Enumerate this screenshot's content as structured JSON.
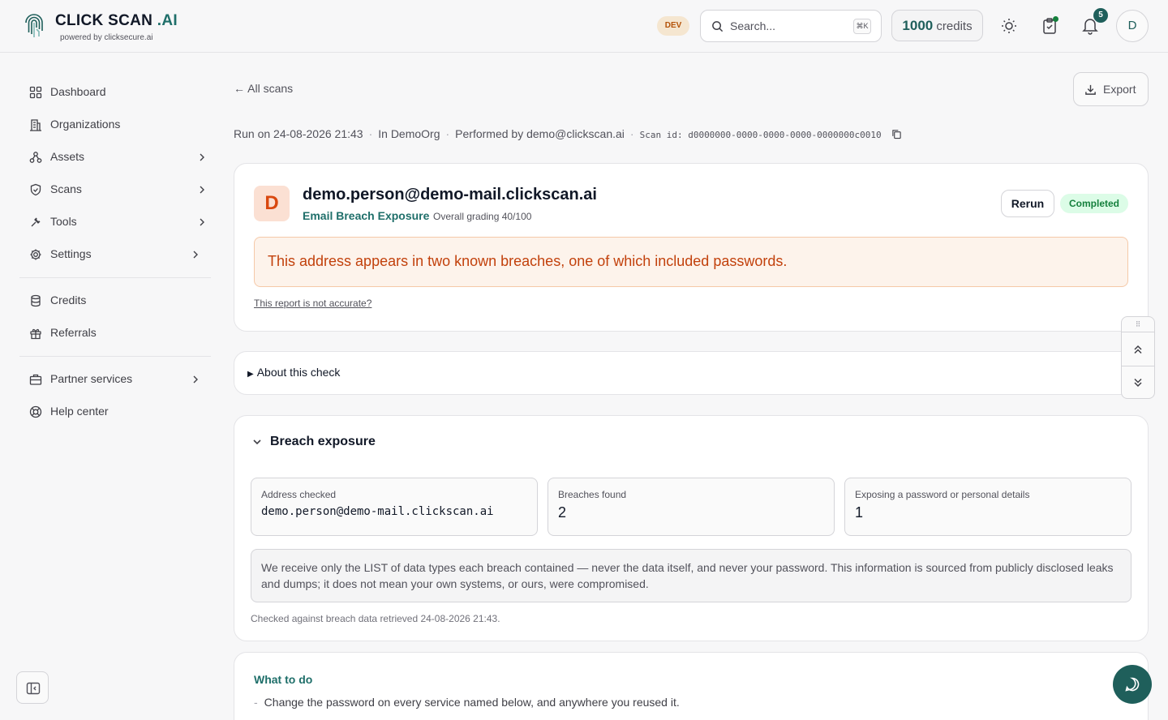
{
  "header": {
    "brand_name": "CLICK SCAN",
    "brand_suffix": ".AI",
    "brand_sub": "powered by clicksecure.ai",
    "env_badge": "DEV",
    "search_placeholder": "Search...",
    "search_shortcut": "⌘K",
    "credits_value": "1000",
    "credits_label": "credits",
    "notifications_count": "5",
    "avatar_initial": "D",
    "accent_color": "#1f5f5b"
  },
  "sidebar": {
    "group1": [
      {
        "label": "Dashboard",
        "icon": "grid-icon",
        "chevron": false
      },
      {
        "label": "Organizations",
        "icon": "building-icon",
        "chevron": false
      },
      {
        "label": "Assets",
        "icon": "network-icon",
        "chevron": true
      },
      {
        "label": "Scans",
        "icon": "shield-icon",
        "chevron": true
      },
      {
        "label": "Tools",
        "icon": "wrench-icon",
        "chevron": true
      },
      {
        "label": "Settings",
        "icon": "gear-icon",
        "chevron": true
      }
    ],
    "group2": [
      {
        "label": "Credits",
        "icon": "database-icon"
      },
      {
        "label": "Referrals",
        "icon": "gift-icon"
      }
    ],
    "group3": [
      {
        "label": "Partner services",
        "icon": "briefcase-icon",
        "chevron": true
      },
      {
        "label": "Help center",
        "icon": "lifebuoy-icon",
        "chevron": false
      }
    ]
  },
  "page": {
    "back_label": "All scans",
    "export_label": "Export",
    "run_on": "Run on 24-08-2026 21:43",
    "org": "In DemoOrg",
    "performed_by": "Performed by demo@clickscan.ai",
    "scan_id": "Scan id: d0000000-0000-0000-0000-0000000c0010"
  },
  "result": {
    "grade_letter": "D",
    "target": "demo.person@demo-mail.clickscan.ai",
    "check_name": "Email Breach Exposure",
    "grading": "Overall grading 40/100",
    "rerun_label": "Rerun",
    "status": "Completed",
    "summary": "This address appears in two known breaches, one of which included passwords.",
    "feedback_link": "This report is not accurate?"
  },
  "about": {
    "label": "About this check"
  },
  "breach": {
    "title": "Breach exposure",
    "stats": [
      {
        "label": "Address checked",
        "value": "demo.person@demo-mail.clickscan.ai"
      },
      {
        "label": "Breaches found",
        "value": "2"
      },
      {
        "label": "Exposing a password or personal details",
        "value": "1"
      }
    ],
    "note": "We receive only the LIST of data types each breach contained — never the data itself, and never your password. This information is sourced from publicly disclosed leaks and dumps; it does not mean your own systems, or ours, were compromised.",
    "checked_against": "Checked against breach data retrieved 24-08-2026 21:43."
  },
  "todo": {
    "title": "What to do",
    "items": [
      "Change the password on every service named below, and anywhere you reused it."
    ]
  }
}
